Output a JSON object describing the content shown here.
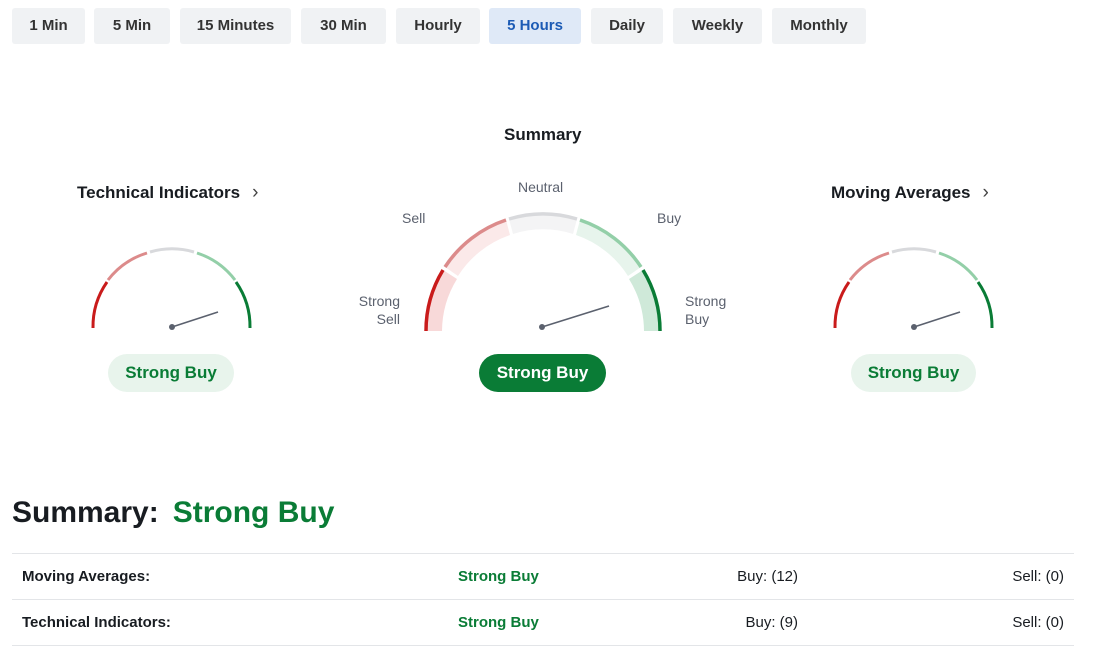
{
  "timeframes": [
    {
      "label": "1 Min",
      "active": false
    },
    {
      "label": "5 Min",
      "active": false
    },
    {
      "label": "15 Minutes",
      "active": false
    },
    {
      "label": "30 Min",
      "active": false
    },
    {
      "label": "Hourly",
      "active": false
    },
    {
      "label": "5 Hours",
      "active": true
    },
    {
      "label": "Daily",
      "active": false
    },
    {
      "label": "Weekly",
      "active": false
    },
    {
      "label": "Monthly",
      "active": false
    }
  ],
  "summary_gauge": {
    "title": "Summary",
    "labels": {
      "neutral": "Neutral",
      "sell": "Sell",
      "buy": "Buy",
      "strong_sell_1": "Strong",
      "strong_sell_2": "Sell",
      "strong_buy_1": "Strong",
      "strong_buy_2": "Buy"
    },
    "result": "Strong Buy"
  },
  "technical_indicators": {
    "title": "Technical Indicators",
    "chevron_icon": "chevron-right-icon",
    "result": "Strong Buy"
  },
  "moving_averages": {
    "title": "Moving Averages",
    "chevron_icon": "chevron-right-icon",
    "result": "Strong Buy"
  },
  "summary_section": {
    "label": "Summary:",
    "value": "Strong Buy",
    "rows": [
      {
        "name": "Moving Averages:",
        "value": "Strong Buy",
        "buy": "Buy: (12)",
        "sell": "Sell: (0)"
      },
      {
        "name": "Technical Indicators:",
        "value": "Strong Buy",
        "buy": "Buy: (9)",
        "sell": "Sell: (0)"
      }
    ]
  },
  "colors": {
    "strong_sell": "#c91b1b",
    "sell": "#dc8b8b",
    "neutral": "#d8d9dc",
    "buy": "#93cfa8",
    "strong_buy": "#0a7c36",
    "active_tab_text": "#1c5bb5",
    "active_tab_bg": "#dfe9f7",
    "needle": "#5b616e"
  }
}
